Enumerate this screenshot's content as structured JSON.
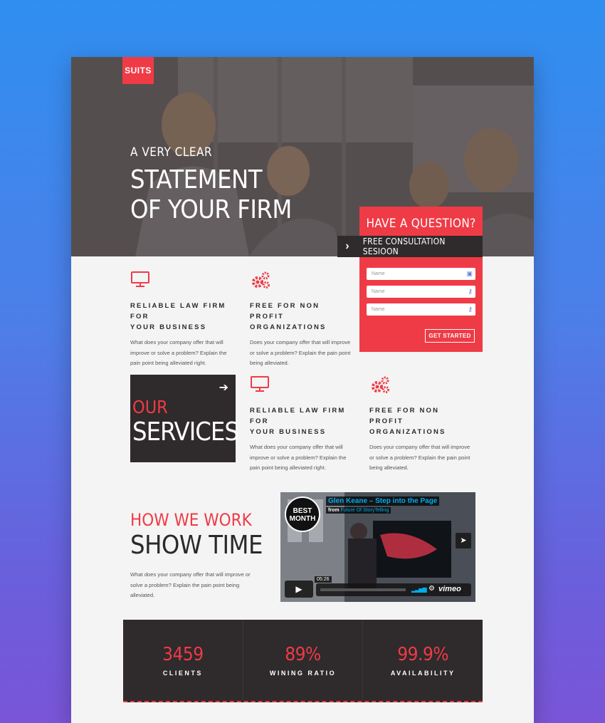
{
  "brand": {
    "logo": "SUITS",
    "accent": "#ef3b46",
    "dark": "#2f2a2b"
  },
  "hero": {
    "kicker": "A VERY CLEAR",
    "title_line1": "STATEMENT",
    "title_line2": "OF YOUR FIRM"
  },
  "question": {
    "title": "HAVE A QUESTION?",
    "bar_label": "FREE CONSULTATION SESIOON",
    "fields": [
      {
        "placeholder": "Name",
        "icon": "contact-card-icon"
      },
      {
        "placeholder": "Name",
        "icon": "key-icon"
      },
      {
        "placeholder": "Name",
        "icon": "key-icon"
      }
    ],
    "button": "GET STARTED"
  },
  "features_row1": [
    {
      "icon": "monitor-icon",
      "title_l1": "RELIABLE LAW FIRM FOR",
      "title_l2": "YOUR BUSINESS",
      "text": "What does your company offer that will improve or solve a problem? Explain the pain point being alleviated right."
    },
    {
      "icon": "gears-icon",
      "title_l1": "FREE FOR NON PROFIT",
      "title_l2": "ORGANIZATIONS",
      "text": "Does your company offer that will improve or solve a problem? Explain the pain point being alleviated."
    }
  ],
  "services": {
    "line1": "OUR",
    "line2": "SERVICES"
  },
  "features_row2": [
    {
      "icon": "monitor-icon",
      "title_l1": "RELIABLE LAW FIRM FOR",
      "title_l2": "YOUR BUSINESS",
      "text": "What does your company offer that will improve or solve a problem? Explain the pain point being alleviated right."
    },
    {
      "icon": "gears-icon",
      "title_l1": "FREE FOR NON PROFIT",
      "title_l2": "ORGANIZATIONS",
      "text": "Does your company offer that will improve or solve a problem? Explain the pain point being alleviated."
    }
  ],
  "how": {
    "line1": "HOW WE WORK",
    "line2": "SHOW TIME",
    "text": "What does your company offer that will improve or solve a problem? Explain the pain point being alleviated."
  },
  "video": {
    "badge_l1": "BEST",
    "badge_l2": "MONTH",
    "title": "Glen Keane – Step into the Page",
    "from_prefix": "from",
    "from_channel": "Future Of StoryTelling",
    "time": "05:26",
    "provider": "vimeo"
  },
  "stats": [
    {
      "value": "3459",
      "label": "CLIENTS"
    },
    {
      "value": "89%",
      "label": "WINING RATIO"
    },
    {
      "value": "99.9%",
      "label": "AVAILABILITY"
    }
  ]
}
